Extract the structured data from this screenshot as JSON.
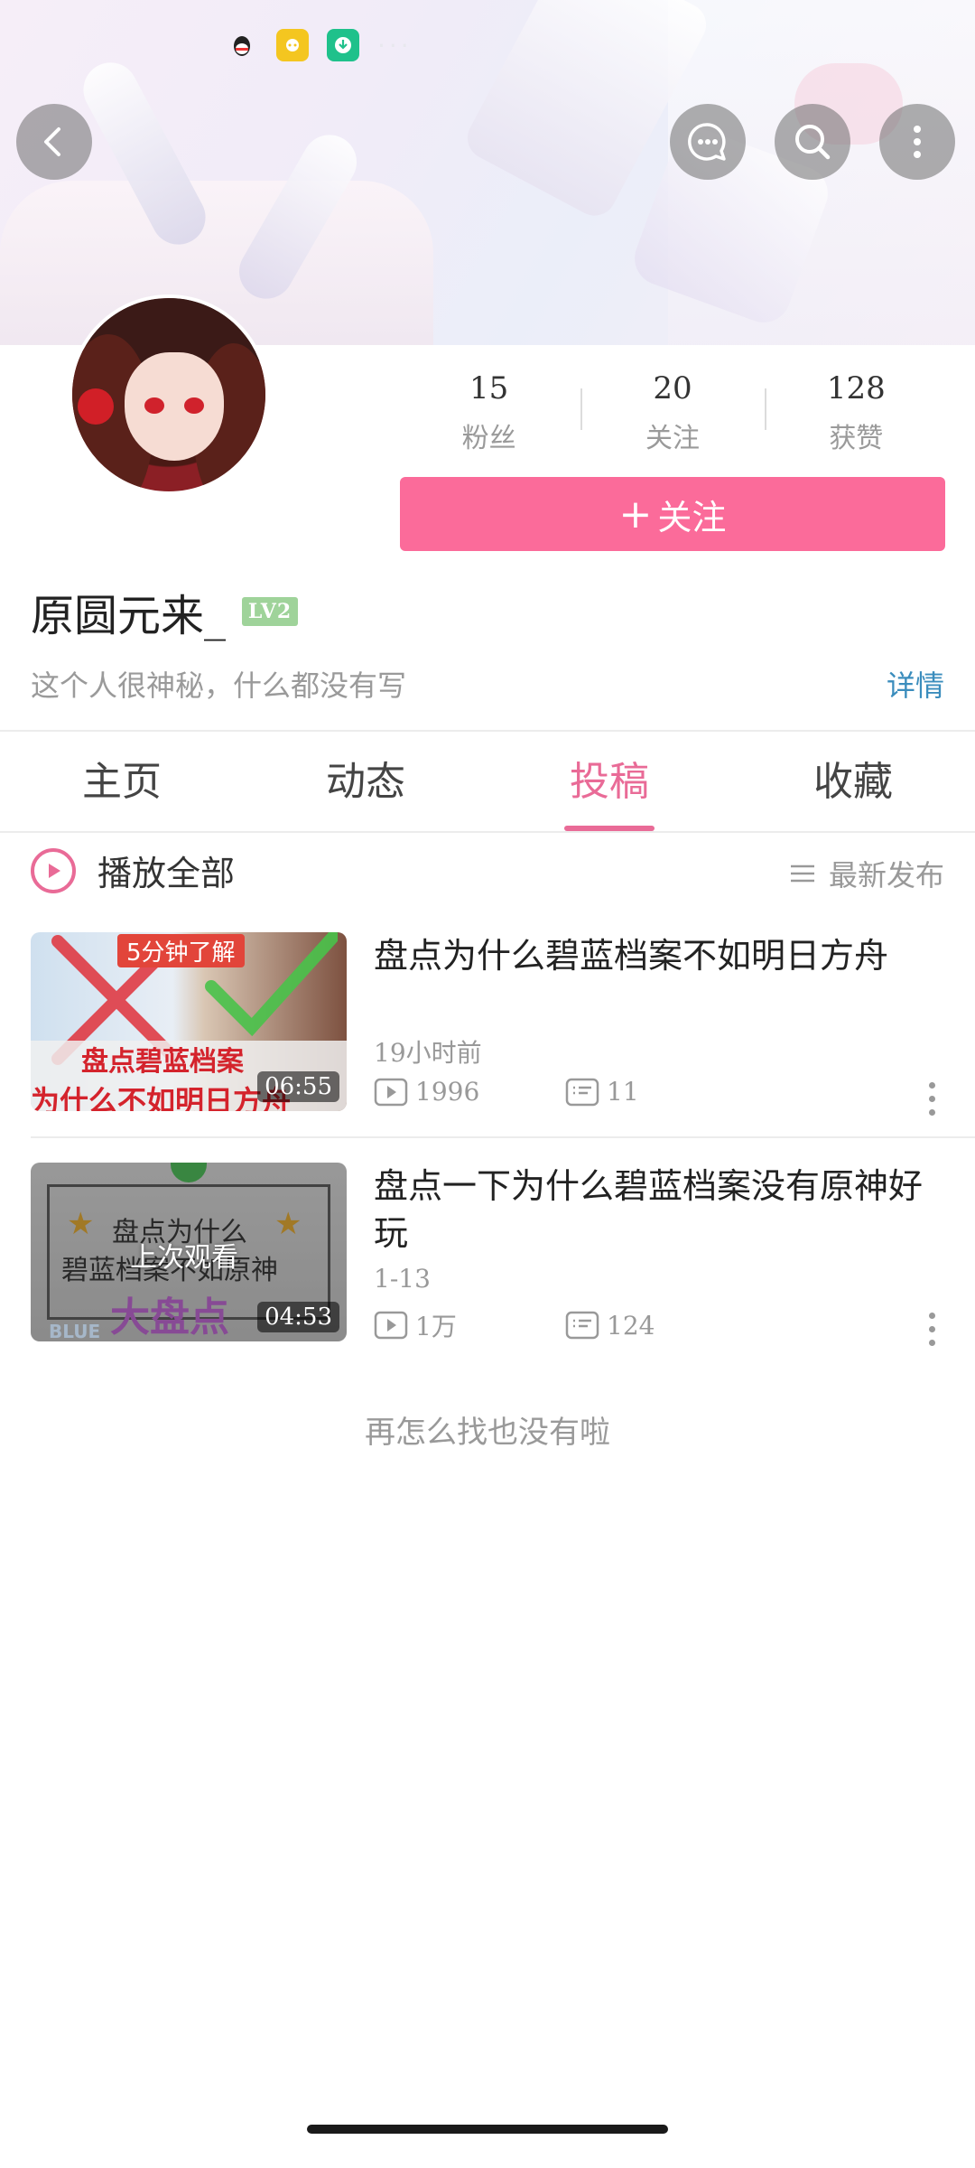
{
  "header": {
    "status_dots": "···",
    "buttons": {
      "back": "back-icon",
      "message": "chat-bubble-icon",
      "search": "search-icon",
      "more": "more-vertical-icon"
    }
  },
  "profile": {
    "stats": [
      {
        "value": "15",
        "label": "粉丝"
      },
      {
        "value": "20",
        "label": "关注"
      },
      {
        "value": "128",
        "label": "获赞"
      }
    ],
    "follow_label": "关注",
    "follow_icon": "+",
    "username": "原圆元来_",
    "level": "LV2",
    "bio": "这个人很神秘，什么都没有写",
    "detail_link": "详情"
  },
  "tabs": [
    {
      "label": "主页",
      "active": false
    },
    {
      "label": "动态",
      "active": false
    },
    {
      "label": "投稿",
      "active": true
    },
    {
      "label": "收藏",
      "active": false
    }
  ],
  "list_header": {
    "play_all": "播放全部",
    "sort_label": "最新发布"
  },
  "videos": [
    {
      "title": "盘点为什么碧蓝档案不如明日方舟",
      "time": "19小时前",
      "views": "1996",
      "comments": "11",
      "duration": "06:55",
      "thumb_text_top": "5分钟了解",
      "thumb_text_mid": "盘点碧蓝档案",
      "thumb_text_bottom": "为什么不如明日方舟",
      "overlay": ""
    },
    {
      "title": "盘点一下为什么碧蓝档案没有原神好玩",
      "time": "1-13",
      "views": "1万",
      "comments": "124",
      "duration": "04:53",
      "thumb_text_top": "盘点为什么",
      "thumb_text_mid": "碧蓝档案不如原神",
      "thumb_text_bottom": "大盘点",
      "thumb_text_corner": "BLUE",
      "overlay": "上次观看"
    }
  ],
  "footer_text": "再怎么找也没有啦",
  "colors": {
    "accent": "#fb6b9a",
    "tab_active": "#e96b97",
    "link": "#3b8dbd",
    "muted": "#999999"
  }
}
